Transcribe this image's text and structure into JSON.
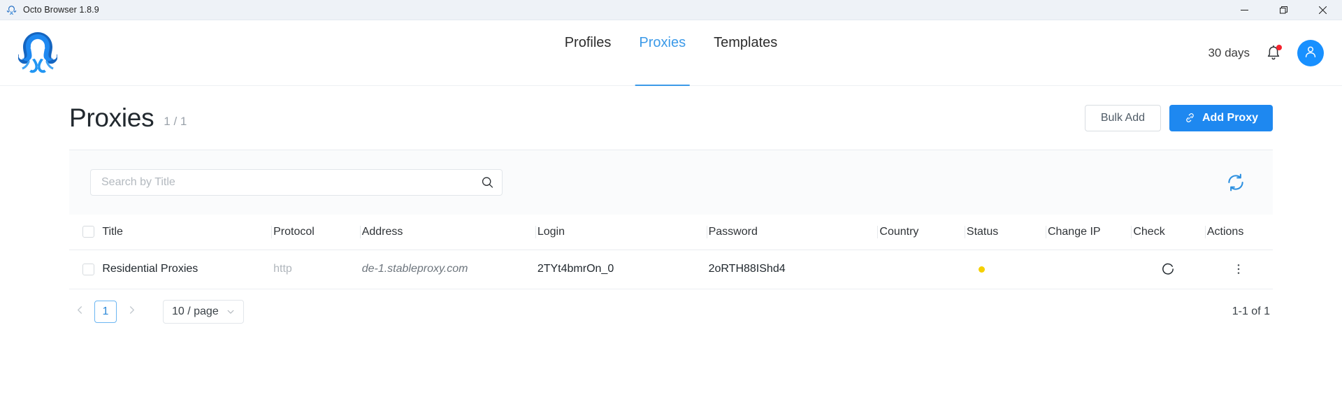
{
  "window": {
    "title": "Octo Browser 1.8.9",
    "logo_icon": "octopus-logo-icon",
    "controls": {
      "minimize": "minimize-icon",
      "maximize": "restore-icon",
      "close": "close-icon"
    }
  },
  "header": {
    "brand_icon": "octopus-brand-logo",
    "nav": [
      {
        "label": "Profiles",
        "active": false
      },
      {
        "label": "Proxies",
        "active": true
      },
      {
        "label": "Templates",
        "active": false
      }
    ],
    "days_label": "30 days",
    "bell_icon": "bell-icon",
    "bell_has_badge": true,
    "avatar_icon": "user-avatar-icon",
    "accent_color": "#1e88f0",
    "active_tab_color": "#3c9ae8",
    "badge_color": "#f5222d"
  },
  "page": {
    "title": "Proxies",
    "count": "1 / 1",
    "bulk_add_label": "Bulk Add",
    "add_proxy_label": "Add Proxy",
    "add_proxy_icon": "link-chain-icon"
  },
  "search": {
    "placeholder": "Search by Title",
    "value": "",
    "search_icon": "search-icon",
    "refresh_icon": "refresh-sync-icon"
  },
  "table": {
    "columns": [
      "Title",
      "Protocol",
      "Address",
      "Login",
      "Password",
      "Country",
      "Status",
      "Change IP",
      "Check",
      "Actions"
    ],
    "rows": [
      {
        "title": "Residential Proxies",
        "protocol": "http",
        "address": "de-1.stableproxy.com",
        "login": "2TYt4bmrOn_0",
        "password": "2oRTH88IShd4",
        "country": "",
        "status": "",
        "status_color": "#f5d000",
        "change_ip": "",
        "check_icon": "refresh-check-icon",
        "actions_icon": "more-vertical-icon"
      }
    ]
  },
  "pagination": {
    "prev_icon": "chevron-left-icon",
    "next_icon": "chevron-right-icon",
    "current_page": "1",
    "page_size_label": "10 / page",
    "page_size_icon": "chevron-down-icon",
    "total_label": "1-1 of 1"
  }
}
